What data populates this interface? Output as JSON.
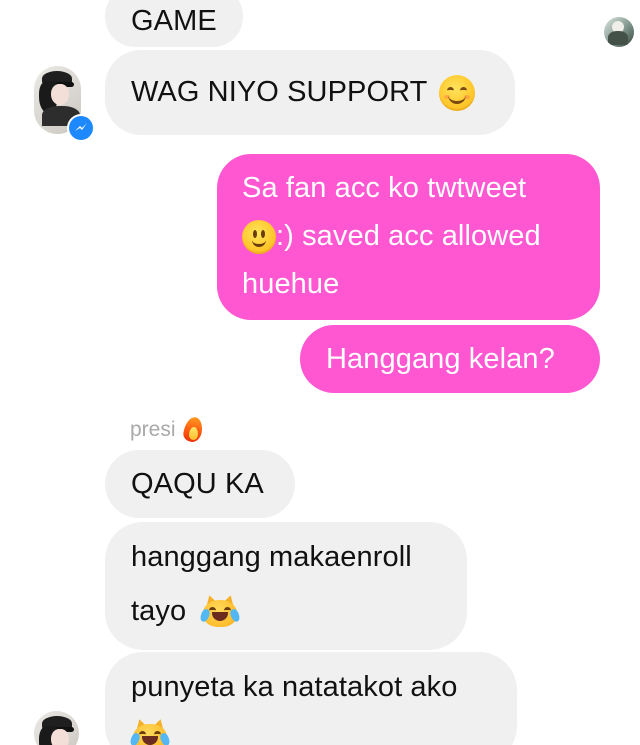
{
  "colors": {
    "incoming_bubble": "#f0f0f0",
    "outgoing_bubble": "#ff57d2",
    "sender_name": "#a9a9a9",
    "messenger_badge": "#1e88ff"
  },
  "messages": [
    {
      "side": "incoming",
      "lines": [
        "GAME"
      ]
    },
    {
      "side": "incoming",
      "lines": [
        "WAG NIYO SUPPORT"
      ],
      "emoji": "smiling-face-icon"
    },
    {
      "side": "outgoing",
      "lines": [
        "Sa fan acc ko twtweet",
        ":) saved acc allowed",
        "huehue"
      ],
      "emoji": "slightly-smiling-face-icon"
    },
    {
      "side": "outgoing",
      "lines": [
        "Hanggang kelan?"
      ]
    },
    {
      "side": "incoming",
      "sender": "presi",
      "sender_emoji": "fire-icon",
      "lines": [
        "QAQU KA"
      ]
    },
    {
      "side": "incoming",
      "lines": [
        "hanggang makaenroll",
        "tayo"
      ],
      "emoji": "cat-tears-of-joy-icon"
    },
    {
      "side": "incoming",
      "lines": [
        "punyeta ka natatakot ako"
      ],
      "emoji": "cat-tears-of-joy-icon"
    }
  ]
}
